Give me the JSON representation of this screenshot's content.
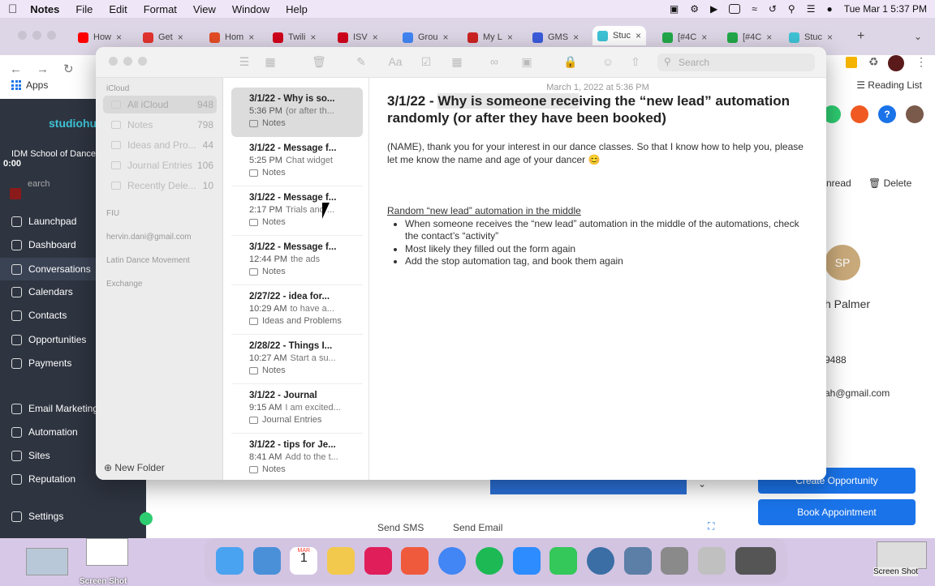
{
  "menubar": {
    "app_name": "Notes",
    "items": [
      "File",
      "Edit",
      "Format",
      "View",
      "Window",
      "Help"
    ],
    "clock": "Tue Mar 1  5:37 PM"
  },
  "browser": {
    "tabs": [
      "How",
      "Get",
      "Hom",
      "Twili",
      "ISV",
      "Grou",
      "My L",
      "GMS",
      "Stuc",
      "[#4C",
      "[#4C",
      "Stuc"
    ],
    "tab_colors": [
      "#ff0000",
      "#e3342f",
      "#e44d26",
      "#d0021b",
      "#d0021b",
      "#4285f4",
      "#cc2222",
      "#3b5bdb",
      "#3ec3d6",
      "#22a849",
      "#22a849",
      "#3ec3d6"
    ],
    "bookmarks_label": "Apps",
    "reading_list": "Reading List"
  },
  "app_sidebar": {
    "logo": "studiohul",
    "school": "IDM School of Dance",
    "timer": "0:00",
    "search_placeholder": "earch",
    "nav": [
      "Launchpad",
      "Dashboard",
      "Conversations",
      "Calendars",
      "Contacts",
      "Opportunities",
      "Payments",
      "Email Marketing",
      "Automation",
      "Sites",
      "Reputation",
      "Settings"
    ]
  },
  "right_app": {
    "unread": "nread",
    "delete": "Delete",
    "initials": "SP",
    "name": "h Palmer",
    "phone": "9488",
    "email": "ah@gmail.com",
    "create_opportunity": "Create Opportunity",
    "book_appointment": "Book Appointment",
    "send_sms": "Send SMS",
    "send_email": "Send Email"
  },
  "notes": {
    "search_placeholder": "Search",
    "folders": {
      "section1": "iCloud",
      "items": [
        {
          "name": "All iCloud",
          "count": "948"
        },
        {
          "name": "Notes",
          "count": "798"
        },
        {
          "name": "Ideas and Pro...",
          "count": "44"
        },
        {
          "name": "Journal Entries",
          "count": "106"
        },
        {
          "name": "Recently Dele...",
          "count": "10"
        }
      ],
      "section2": "FIU",
      "section3": "hervin.dani@gmail.com",
      "section4": "Latin Dance Movement",
      "section5": "Exchange",
      "new_folder": "New Folder"
    },
    "list": [
      {
        "title": "3/1/22 - Why is so...",
        "time": "5:36 PM",
        "snippet": "(or after th...",
        "folder": "Notes"
      },
      {
        "title": "3/1/22 - Message f...",
        "time": "5:25 PM",
        "snippet": "Chat widget",
        "folder": "Notes"
      },
      {
        "title": "3/1/22 - Message f...",
        "time": "2:17 PM",
        "snippet": "Trials and ...",
        "folder": "Notes"
      },
      {
        "title": "3/1/22 - Message f...",
        "time": "12:44 PM",
        "snippet": "the ads",
        "folder": "Notes"
      },
      {
        "title": "2/27/22 - idea for...",
        "time": "10:29 AM",
        "snippet": "to have a...",
        "folder": "Ideas and Problems"
      },
      {
        "title": "2/28/22 - Things I...",
        "time": "10:27 AM",
        "snippet": "Start a su...",
        "folder": "Notes"
      },
      {
        "title": "3/1/22 - Journal",
        "time": "9:15 AM",
        "snippet": "I am excited...",
        "folder": "Journal Entries"
      },
      {
        "title": "3/1/22 - tips for Je...",
        "time": "8:41 AM",
        "snippet": "Add to the t...",
        "folder": "Notes"
      }
    ],
    "editor": {
      "date": "March 1, 2022 at 5:36 PM",
      "title_pre": "3/1/22 - ",
      "title_hl": "Why is someone rece",
      "title_post": "iving the “new lead” automation randomly (or after they have been booked)",
      "para": "(NAME), thank you for your interest in our dance classes. So that I know how to help you, please let me know the name and age of your dancer 😊",
      "subheading": "Random “new lead” automation in the middle",
      "bullets": [
        "When someone receives the “new lead” automation in the middle of the automations, check the contact’s “activity”",
        "Most likely they filled out the form again",
        "Add the stop automation tag, and book them again"
      ]
    }
  },
  "desktop": {
    "screenshot_label_left": "Screen Shot",
    "screenshot_label_right": "Screen Shot",
    "dock_colors": [
      "#4aa3f0",
      "#4a90d9",
      "#ff3b30",
      "#f2c94c",
      "#e01e5a",
      "#f05a3c",
      "#4285f4",
      "#1db954",
      "#2d8cff",
      "#34c759",
      "#3a6ea5",
      "#5b7fa6",
      "#8a8a8a",
      "#c0c0c0",
      "#555555"
    ],
    "calendar_day": "1",
    "calendar_month": "MAR"
  }
}
